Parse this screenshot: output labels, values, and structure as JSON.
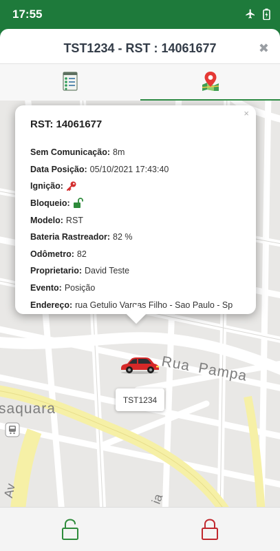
{
  "status_bar": {
    "time": "17:55"
  },
  "header": {
    "title": "TST1234 - RST : 14061677",
    "close": "✖"
  },
  "popup": {
    "close": "×",
    "title": "RST: 14061677",
    "rows": [
      {
        "label": "Sem Comunicação:",
        "value": "8m"
      },
      {
        "label": "Data Posição:",
        "value": "05/10/2021 17:43:40"
      },
      {
        "label": "Ignição:",
        "value": ""
      },
      {
        "label": "Bloqueio:",
        "value": ""
      },
      {
        "label": "Modelo:",
        "value": "RST"
      },
      {
        "label": "Bateria Rastreador:",
        "value": "82 %"
      },
      {
        "label": "Odômetro:",
        "value": "82"
      },
      {
        "label": "Proprietario:",
        "value": "David Teste"
      },
      {
        "label": "Evento:",
        "value": "Posição"
      },
      {
        "label": "Endereço:",
        "value": "rua Getulio Vargas Filho - Sao Paulo - Sp"
      }
    ]
  },
  "map": {
    "streets": {
      "pampa": "Rua Pampa",
      "saquara": "saquara",
      "av": "Av",
      "ia": "ia"
    },
    "vehicle_plate": "TST1234"
  },
  "colors": {
    "brand_green": "#1e7a3b",
    "unlock_green": "#2e8b3b",
    "lock_red": "#c0272d",
    "car_red": "#d62828"
  }
}
